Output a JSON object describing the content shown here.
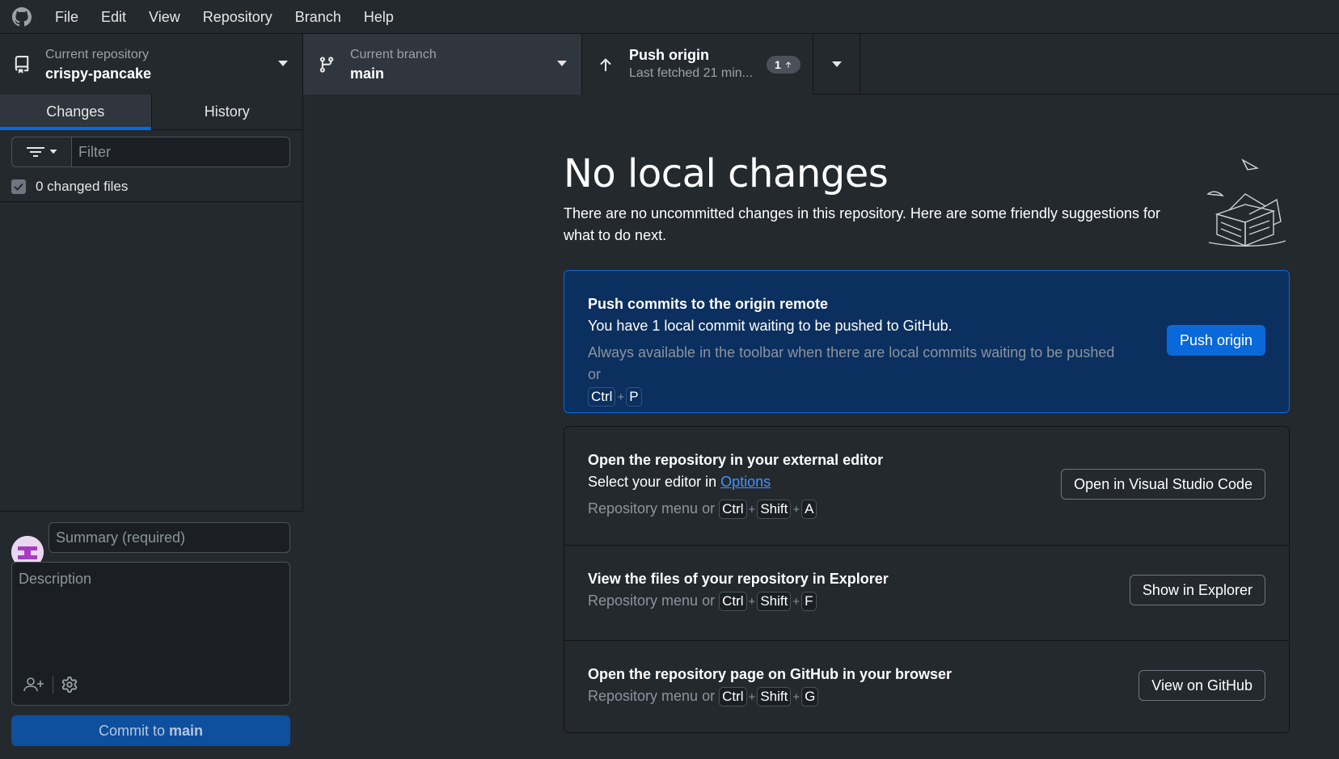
{
  "menubar": {
    "logo_icon": "github-octocat-icon",
    "items": [
      "File",
      "Edit",
      "View",
      "Repository",
      "Branch",
      "Help"
    ]
  },
  "toolbar": {
    "repository": {
      "title": "Current repository",
      "value": "crispy-pancake"
    },
    "branch": {
      "title": "Current branch",
      "value": "main"
    },
    "push": {
      "title": "Push origin",
      "subtitle": "Last fetched 21 min...",
      "badge_count": "1"
    }
  },
  "sidebar": {
    "tabs": [
      "Changes",
      "History"
    ],
    "active_tab": "Changes",
    "filter_placeholder": "Filter",
    "changed_files_label": "0 changed files",
    "commit": {
      "summary_placeholder": "Summary (required)",
      "description_placeholder": "Description",
      "button_prefix": "Commit to",
      "button_branch": "main"
    }
  },
  "main": {
    "heading": "No local changes",
    "subheading": "There are no uncommitted changes in this repository. Here are some friendly suggestions for what to do next.",
    "push_card": {
      "title": "Push commits to the origin remote",
      "description": "You have 1 local commit waiting to be pushed to GitHub.",
      "hint": "Always available in the toolbar when there are local commits waiting to be pushed or",
      "shortcut": [
        "Ctrl",
        "P"
      ],
      "button": "Push origin"
    },
    "editor_card": {
      "title": "Open the repository in your external editor",
      "description_prefix": "Select your editor in",
      "description_link": "Options",
      "hint": "Repository menu or",
      "shortcut": [
        "Ctrl",
        "Shift",
        "A"
      ],
      "button": "Open in Visual Studio Code"
    },
    "explorer_card": {
      "title": "View the files of your repository in Explorer",
      "hint": "Repository menu or",
      "shortcut": [
        "Ctrl",
        "Shift",
        "F"
      ],
      "button": "Show in Explorer"
    },
    "github_card": {
      "title": "Open the repository page on GitHub in your browser",
      "hint": "Repository menu or",
      "shortcut": [
        "Ctrl",
        "Shift",
        "G"
      ],
      "button": "View on GitHub"
    }
  },
  "colors": {
    "background": "#24292e",
    "accent_blue": "#0969da",
    "push_card_bg": "#0b2f5e",
    "commit_button_bg": "#0e4f9e"
  }
}
